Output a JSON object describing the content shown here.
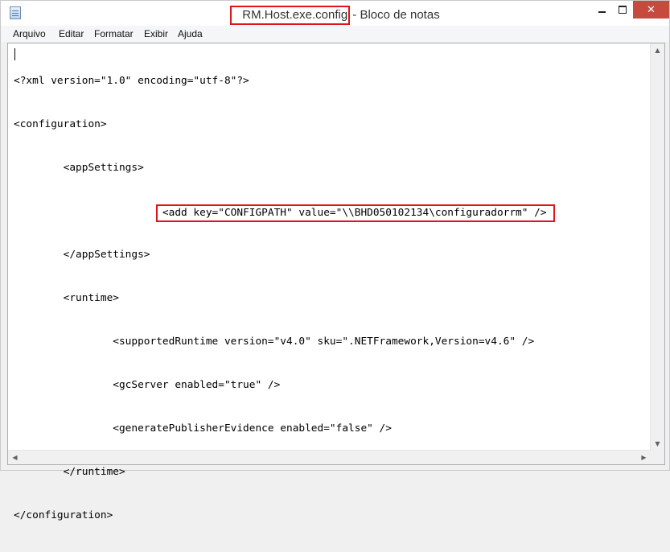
{
  "window": {
    "title_file": "RM.Host.exe.config",
    "title_rest": "- Bloco de notas",
    "controls": {
      "minimize": "",
      "maximize": "",
      "close": "✕"
    }
  },
  "menu": {
    "items": [
      "Arquivo",
      "Editar",
      "Formatar",
      "Exibir",
      "Ajuda"
    ]
  },
  "editor": {
    "lines": [
      "<?xml version=\"1.0\" encoding=\"utf-8\"?>",
      "<configuration>",
      "        <appSettings>",
      "                        <add key=\"CONFIGPATH\" value=\"\\\\BHD050102134\\configuradorrm\" />",
      "        </appSettings>",
      "        <runtime>",
      "                <supportedRuntime version=\"v4.0\" sku=\".NETFramework,Version=v4.6\" />",
      "                <gcServer enabled=\"true\" />",
      "                <generatePublisherEvidence enabled=\"false\" />",
      "        </runtime>",
      "</configuration>"
    ],
    "highlight_prefix": "                        ",
    "highlight_text": "<add key=\"CONFIGPATH\" value=\"\\\\BHD050102134\\configuradorrm\" />"
  },
  "scrollbars": {
    "up": "▲",
    "down": "▼",
    "left": "◀",
    "right": "▶"
  },
  "colors": {
    "highlight_border": "#e0141b",
    "close_button": "#c74a3f"
  }
}
